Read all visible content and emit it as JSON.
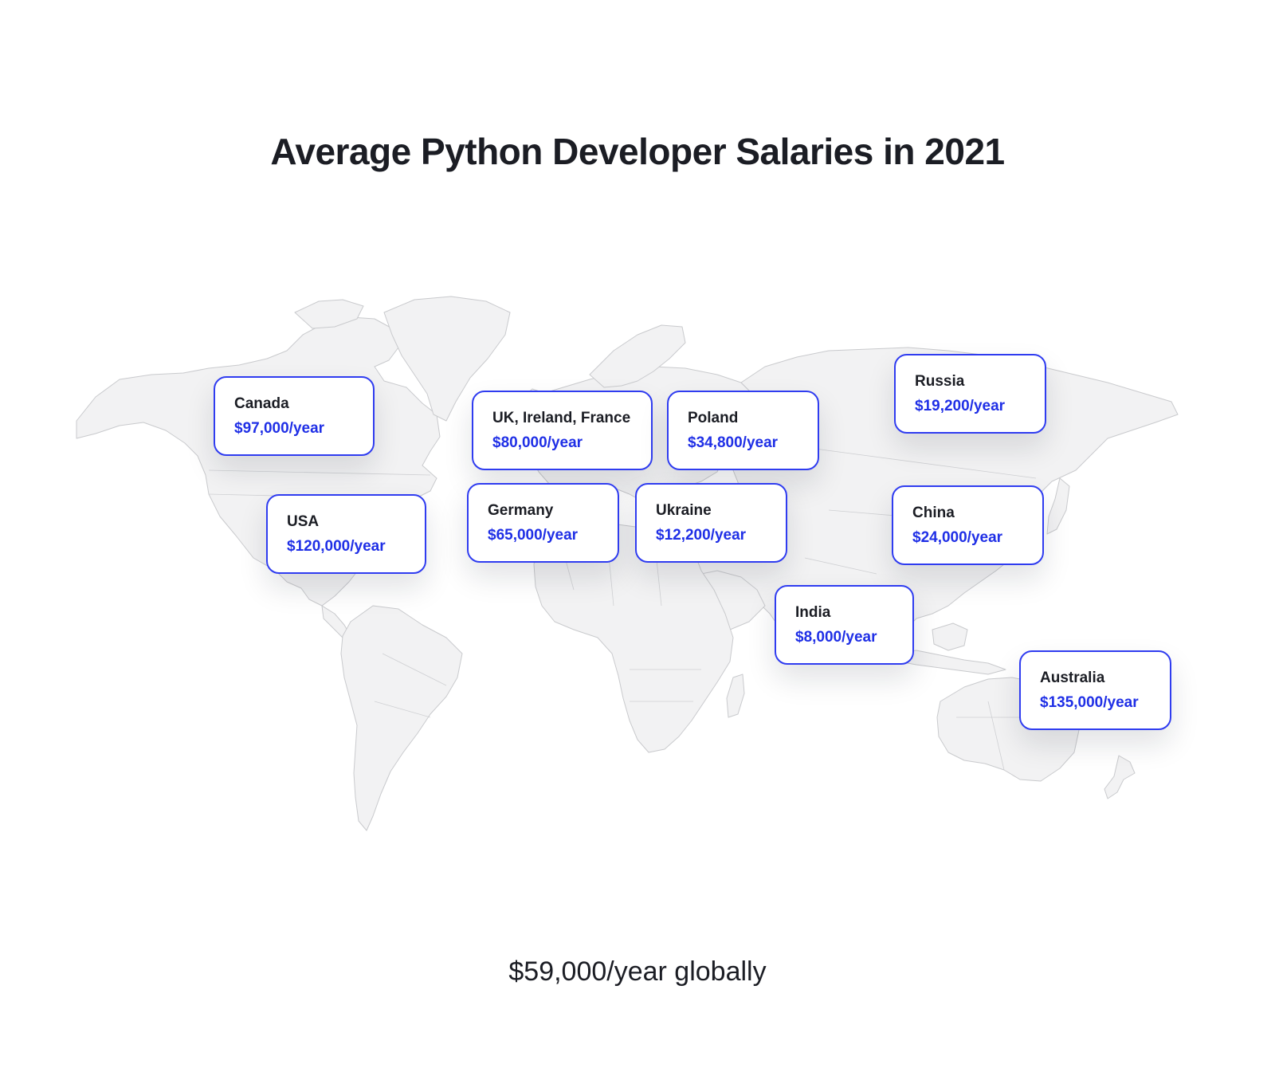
{
  "title": "Average Python Developer Salaries in 2021",
  "footer": "$59,000/year globally",
  "accent_color": "#2f3cf0",
  "salary_color": "#1f2fe6",
  "map_fill": "#f2f2f3",
  "regions": [
    {
      "country": "Canada",
      "salary": "$97,000/year"
    },
    {
      "country": "USA",
      "salary": "$120,000/year"
    },
    {
      "country": "UK, Ireland, France",
      "salary": "$80,000/year"
    },
    {
      "country": "Poland",
      "salary": "$34,800/year"
    },
    {
      "country": "Russia",
      "salary": "$19,200/year"
    },
    {
      "country": "Germany",
      "salary": "$65,000/year"
    },
    {
      "country": "Ukraine",
      "salary": "$12,200/year"
    },
    {
      "country": "China",
      "salary": "$24,000/year"
    },
    {
      "country": "India",
      "salary": "$8,000/year"
    },
    {
      "country": "Australia",
      "salary": "$135,000/year"
    }
  ]
}
